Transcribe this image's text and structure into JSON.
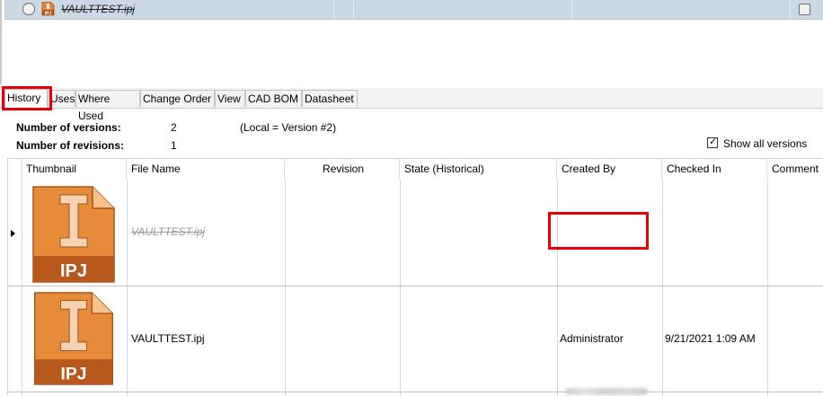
{
  "top_list": {
    "selected_file": "VAULTTEST.ipj",
    "file_icon": "ipj-file-icon"
  },
  "tabs": [
    "History",
    "Uses",
    "Where Used",
    "Change Order",
    "View",
    "CAD BOM",
    "Datasheet"
  ],
  "active_tab": "History",
  "summary": {
    "versions_label": "Number of versions:",
    "versions_value": "2",
    "local_note": "(Local = Version #2)",
    "revisions_label": "Number of revisions:",
    "revisions_value": "1",
    "show_all_label": "Show all versions",
    "show_all_checked": true
  },
  "grid": {
    "columns": [
      "Thumbnail",
      "File Name",
      "Revision",
      "State (Historical)",
      "Created By",
      "Checked In",
      "Comment"
    ],
    "rows": [
      {
        "thumbnail": "ipj-thumbnail-icon",
        "file_name": "VAULTTEST.ipj",
        "revision": "",
        "state": "",
        "created_by": "",
        "checked_in": "",
        "comment": "",
        "thumb_text": "IPJ"
      },
      {
        "thumbnail": "ipj-thumbnail-icon",
        "file_name": "VAULTTEST.ipj",
        "revision": "",
        "state": "",
        "created_by": "Administrator",
        "checked_in": "9/21/2021 1:09 AM",
        "comment": "",
        "thumb_text": "IPJ"
      }
    ]
  },
  "colors": {
    "highlight_box": "#e60000",
    "selection_row": "#cdd8e5",
    "icon_orange": "#d9782d"
  }
}
